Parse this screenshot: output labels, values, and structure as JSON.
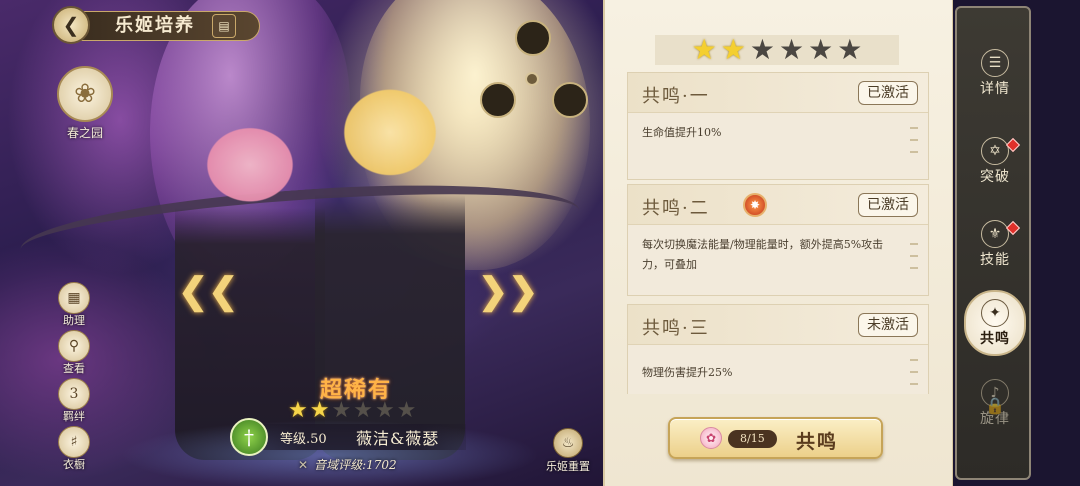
{
  "header": {
    "title": "乐姬培养",
    "back_icon": "back-arrow-icon",
    "doc_icon": "document-icon"
  },
  "spring": {
    "label": "春之园",
    "icon": "flower-icon"
  },
  "side_buttons": [
    {
      "label": "助理",
      "icon": "assistant-icon"
    },
    {
      "label": "查看",
      "icon": "magnify-icon"
    },
    {
      "label": "羁绊",
      "icon": "bond-icon",
      "badge": "3"
    },
    {
      "label": "衣橱",
      "icon": "dress-icon"
    }
  ],
  "character": {
    "rarity": "超稀有",
    "stars_total": 6,
    "stars_filled": 2,
    "level": "等级.50",
    "name": "薇洁&薇瑟",
    "rating_label": "音域评级:",
    "rating_value": "1702",
    "element_icon": "sword-icon"
  },
  "reset": {
    "label": "乐姬重置",
    "icon": "reset-icon"
  },
  "resonance": {
    "stars_total": 6,
    "stars_filled": 2,
    "cards": [
      {
        "name": "共鸣·一",
        "status": "已激活",
        "desc": "生命值提升10%"
      },
      {
        "name": "共鸣·二",
        "status": "已激活",
        "desc": "每次切换魔法能量/物理能量时，额外提高5%攻击力，可叠加",
        "has_skill_icon": true
      },
      {
        "name": "共鸣·三",
        "status": "未激活",
        "desc": "物理伤害提升25%"
      }
    ],
    "button": {
      "count": "8/15",
      "label": "共鸣"
    }
  },
  "tabs": [
    {
      "label": "详情",
      "icon": "details-icon"
    },
    {
      "label": "突破",
      "icon": "breakthrough-icon",
      "alert": true
    },
    {
      "label": "技能",
      "icon": "skill-icon",
      "alert": true
    },
    {
      "label": "共鸣",
      "icon": "resonance-icon",
      "active": true
    },
    {
      "label": "旋律",
      "icon": "melody-icon",
      "locked": true
    }
  ],
  "colors": {
    "accent_gold": "#c9a86a",
    "star_on": "#f4cf30",
    "alert_red": "#e0302a",
    "panel_bg": "#f7f1e2"
  }
}
